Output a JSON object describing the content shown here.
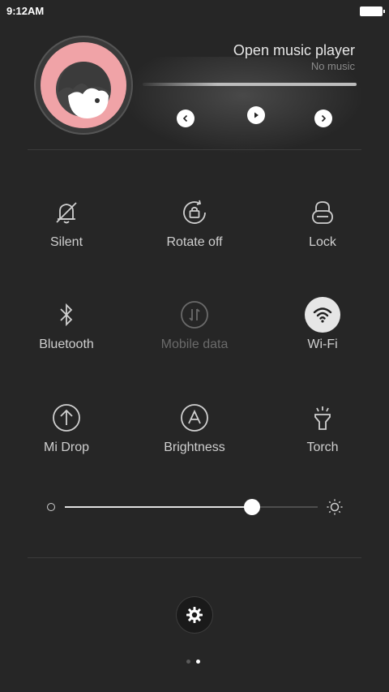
{
  "status_bar": {
    "time": "9:12AM"
  },
  "player": {
    "title": "Open music player",
    "subtitle": "No music",
    "controls": [
      "previous-icon",
      "play-icon",
      "next-icon"
    ],
    "avatar_color": "#f0a3a7"
  },
  "toggles": [
    {
      "label": "Silent",
      "icon": "bell-off-icon",
      "state": "off"
    },
    {
      "label": "Rotate off",
      "icon": "rotate-lock-icon",
      "state": "off"
    },
    {
      "label": "Lock",
      "icon": "lock-icon",
      "state": "off"
    },
    {
      "label": "Bluetooth",
      "icon": "bluetooth-icon",
      "state": "off"
    },
    {
      "label": "Mobile data",
      "icon": "mobile-data-icon",
      "state": "disabled"
    },
    {
      "label": "Wi-Fi",
      "icon": "wifi-icon",
      "state": "on"
    },
    {
      "label": "Mi Drop",
      "icon": "mi-drop-icon",
      "state": "off"
    },
    {
      "label": "Brightness",
      "icon": "auto-brightness-icon",
      "state": "off"
    },
    {
      "label": "Torch",
      "icon": "torch-icon",
      "state": "off"
    }
  ],
  "brightness": {
    "level": 0.74
  },
  "pager": {
    "pages": 2,
    "current": 2
  },
  "colors": {
    "background": "#262626",
    "active": "#e6e6e6",
    "inactive_text": "#6a6a6a"
  }
}
